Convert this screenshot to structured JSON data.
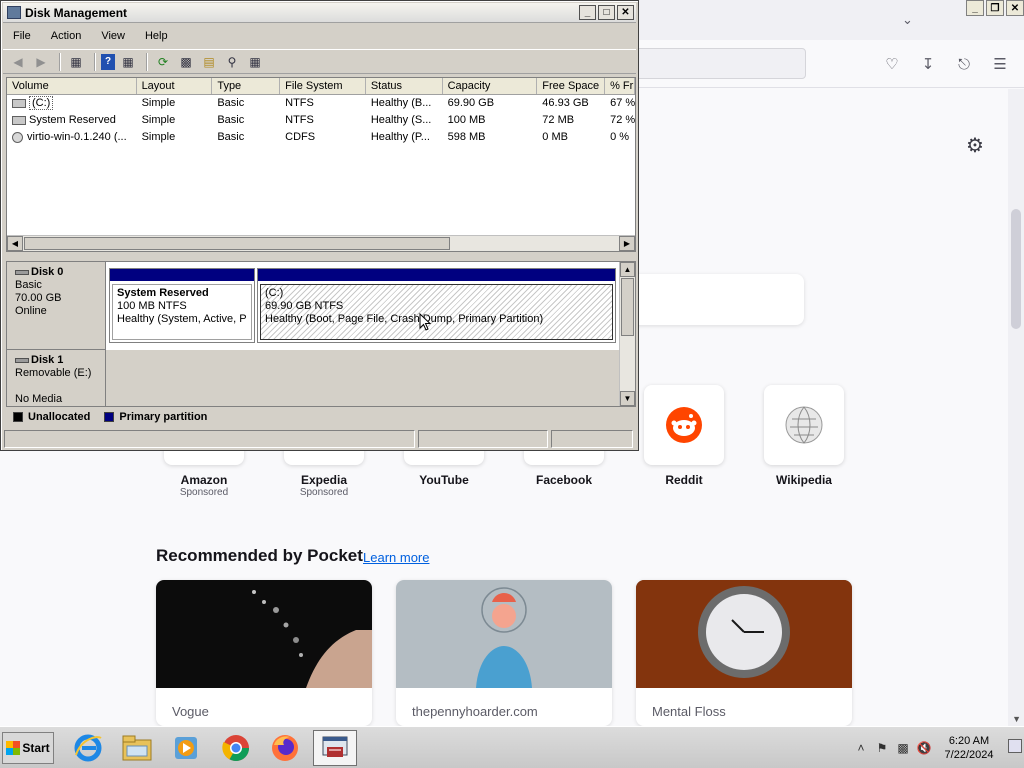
{
  "firefox": {
    "sites": [
      {
        "name": "Amazon",
        "sub": "Sponsored"
      },
      {
        "name": "Expedia",
        "sub": "Sponsored"
      },
      {
        "name": "YouTube",
        "sub": ""
      },
      {
        "name": "Facebook",
        "sub": ""
      },
      {
        "name": "Reddit",
        "sub": ""
      },
      {
        "name": "Wikipedia",
        "sub": ""
      }
    ],
    "pocket_title": "Recommended by Pocket",
    "learn_more": "Learn more",
    "pocket_cards": [
      {
        "source": "Vogue"
      },
      {
        "source": "thepennyhoarder.com"
      },
      {
        "source": "Mental Floss"
      }
    ],
    "colors": {
      "reddit": "#ff4500",
      "link": "#0060df"
    }
  },
  "disk_management": {
    "title": "Disk Management",
    "menu": [
      "File",
      "Action",
      "View",
      "Help"
    ],
    "columns": [
      "Volume",
      "Layout",
      "Type",
      "File System",
      "Status",
      "Capacity",
      "Free Space",
      "% Fr"
    ],
    "volumes": [
      {
        "icon": "disk-icon",
        "volume": "(C:)",
        "layout": "Simple",
        "type": "Basic",
        "fs": "NTFS",
        "status": "Healthy (B...",
        "capacity": "69.90 GB",
        "free": "46.93 GB",
        "pct": "67 %"
      },
      {
        "icon": "disk-icon",
        "volume": "System Reserved",
        "layout": "Simple",
        "type": "Basic",
        "fs": "NTFS",
        "status": "Healthy (S...",
        "capacity": "100 MB",
        "free": "72 MB",
        "pct": "72 %"
      },
      {
        "icon": "cd-icon",
        "volume": "virtio-win-0.1.240 (...",
        "layout": "Simple",
        "type": "Basic",
        "fs": "CDFS",
        "status": "Healthy (P...",
        "capacity": "598 MB",
        "free": "0 MB",
        "pct": "0 %"
      }
    ],
    "disk0": {
      "name": "Disk 0",
      "type": "Basic",
      "size": "70.00 GB",
      "state": "Online",
      "partitions": [
        {
          "name": "System Reserved",
          "size": "100 MB NTFS",
          "status": "Healthy (System, Active, Pr"
        },
        {
          "name": "(C:)",
          "size": "69.90 GB NTFS",
          "status": "Healthy (Boot, Page File, Crash Dump, Primary Partition)"
        }
      ]
    },
    "disk1": {
      "name": "Disk 1",
      "type": "Removable (E:)",
      "state": "No Media"
    },
    "legend": [
      {
        "label": "Unallocated",
        "color": "#000000"
      },
      {
        "label": "Primary partition",
        "color": "#000080"
      }
    ]
  },
  "taskbar": {
    "start": "Start",
    "apps": [
      "internet-explorer-icon",
      "file-explorer-icon",
      "media-player-icon",
      "chrome-icon",
      "firefox-icon",
      "disk-management-icon"
    ],
    "time": "6:20 AM",
    "date": "7/22/2024"
  }
}
